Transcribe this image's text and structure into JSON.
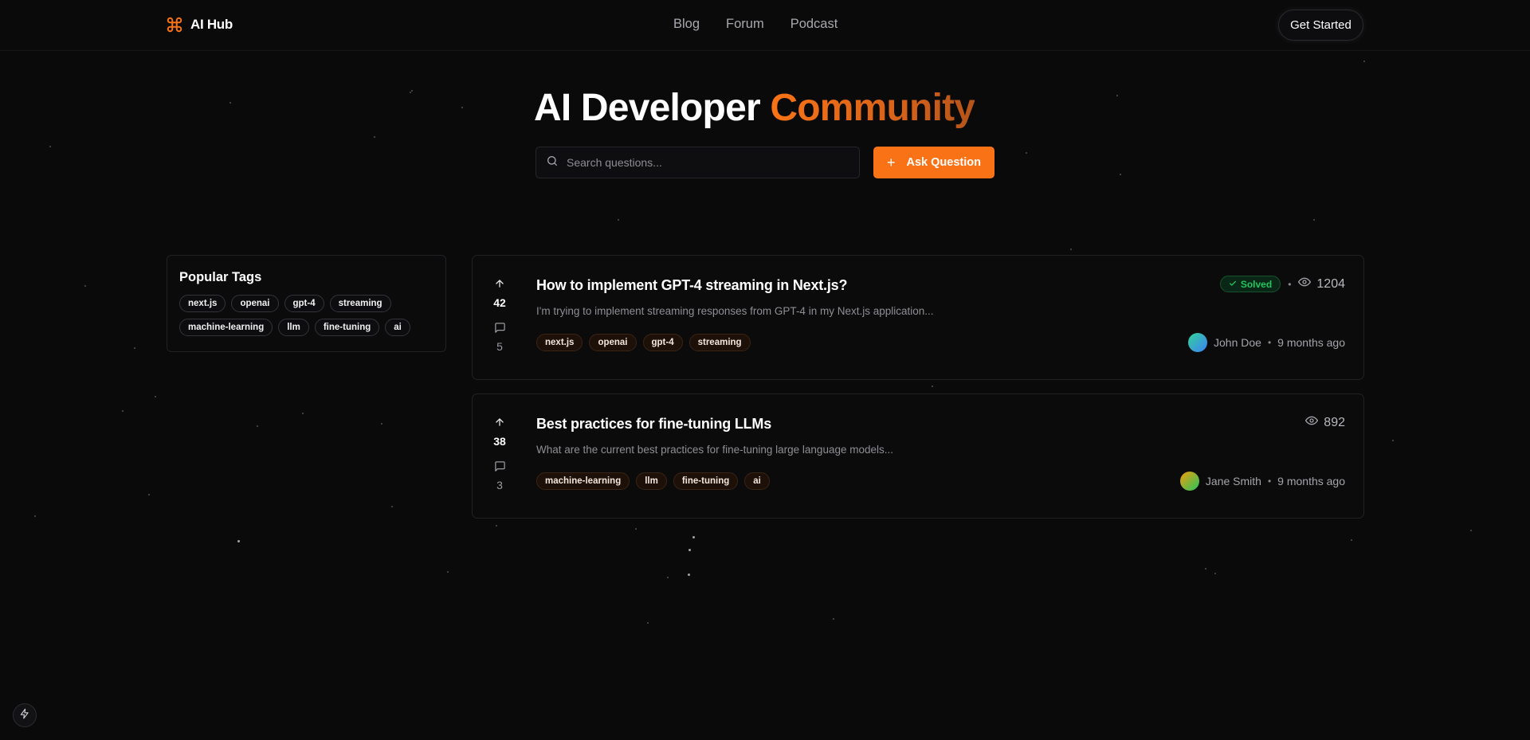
{
  "header": {
    "logo_text": "AI Hub",
    "nav": [
      "Blog",
      "Forum",
      "Podcast"
    ],
    "cta_label": "Get Started"
  },
  "hero": {
    "title_main": "AI Developer",
    "title_accent": "Community",
    "search_placeholder": "Search questions...",
    "ask_button_label": "Ask Question"
  },
  "sidebar": {
    "title": "Popular Tags",
    "tags": [
      "next.js",
      "openai",
      "gpt-4",
      "streaming",
      "machine-learning",
      "llm",
      "fine-tuning",
      "ai"
    ]
  },
  "questions": [
    {
      "votes": "42",
      "comments": "5",
      "title": "How to implement GPT-4 streaming in Next.js?",
      "excerpt": "I'm trying to implement streaming responses from GPT-4 in my Next.js application...",
      "tags": [
        "next.js",
        "openai",
        "gpt-4",
        "streaming"
      ],
      "status": "Solved",
      "views": "1204",
      "author": "John Doe",
      "time": "9 months ago"
    },
    {
      "votes": "38",
      "comments": "3",
      "title": "Best practices for fine-tuning LLMs",
      "excerpt": "What are the current best practices for fine-tuning large language models...",
      "tags": [
        "machine-learning",
        "llm",
        "fine-tuning",
        "ai"
      ],
      "views": "892",
      "author": "Jane Smith",
      "time": "9 months ago"
    }
  ],
  "icons": {
    "logo": "command-icon",
    "search": "search-icon",
    "ask": "plus-icon",
    "upvote": "arrow-up-icon",
    "comments": "message-square-icon",
    "views": "eye-icon",
    "solved": "check-icon",
    "bottom": "lightning-icon"
  },
  "colors": {
    "accent": "#f97316",
    "background": "#0a0a0b",
    "solved": "#22c55e"
  }
}
